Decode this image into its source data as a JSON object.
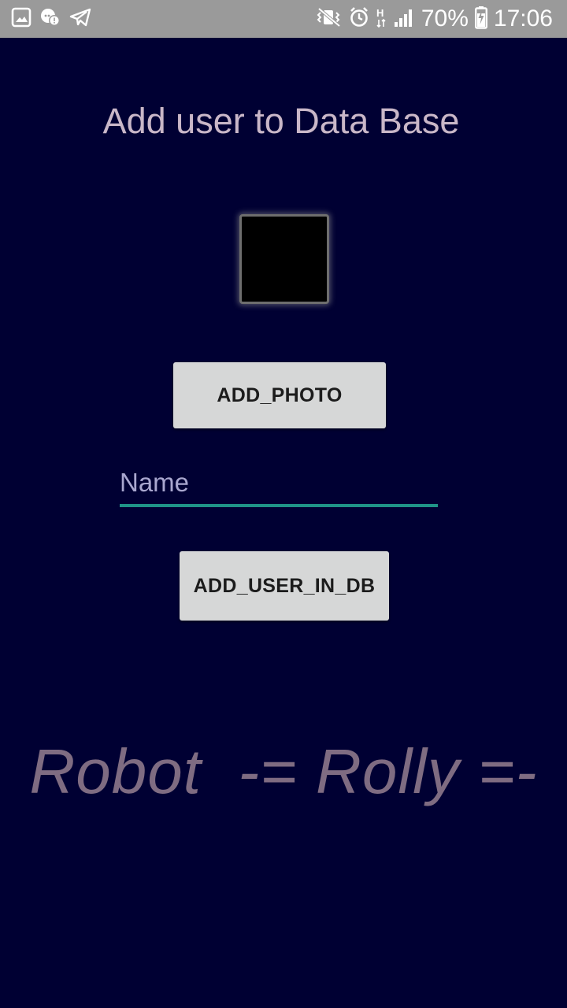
{
  "status_bar": {
    "battery_percent": "70%",
    "time": "17:06",
    "network_type": "H",
    "icons_left": [
      "gallery-icon",
      "chat-icon",
      "telegram-icon"
    ],
    "icons_right": [
      "vibrate-icon",
      "alarm-icon",
      "signal-icon",
      "battery-icon"
    ]
  },
  "screen": {
    "title": "Add user to Data Base",
    "add_photo_label": "ADD_PHOTO",
    "name_placeholder": "Name",
    "name_value": "",
    "add_user_label": "ADD_USER_IN_DB",
    "brand_text": "Robot  -= Rolly =-"
  },
  "colors": {
    "background": "#000033",
    "status_bar": "#9a9a9a",
    "title_text": "#c9b7c8",
    "button_bg": "#d6d7d7",
    "input_underline": "#1f9488",
    "brand_text": "#7f6c82"
  }
}
